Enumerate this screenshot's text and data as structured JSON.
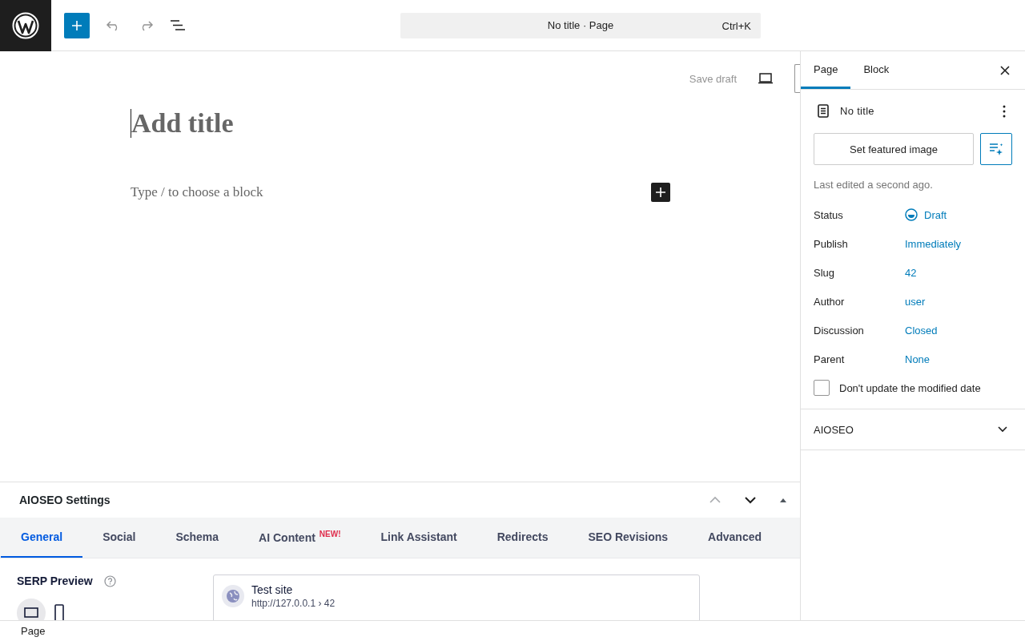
{
  "toolbar": {
    "command_bar": {
      "title": "No title · Page",
      "shortcut": "Ctrl+K"
    }
  },
  "editor": {
    "save_draft": "Save draft",
    "title_placeholder": "Add title",
    "block_placeholder": "Type / to choose a block"
  },
  "sidebar": {
    "tabs": [
      {
        "label": "Page",
        "selected": true
      },
      {
        "label": "Block",
        "selected": false
      }
    ],
    "document_title": "No title",
    "featured_image_button": "Set featured image",
    "last_edited": "Last edited a second ago.",
    "fields": [
      {
        "label": "Status",
        "value": "Draft",
        "kind": "status"
      },
      {
        "label": "Publish",
        "value": "Immediately",
        "kind": "link"
      },
      {
        "label": "Slug",
        "value": "42",
        "kind": "link"
      },
      {
        "label": "Author",
        "value": "user",
        "kind": "link"
      },
      {
        "label": "Discussion",
        "value": "Closed",
        "kind": "link"
      },
      {
        "label": "Parent",
        "value": "None",
        "kind": "link"
      }
    ],
    "checkbox": {
      "label": "Don't update the modified date",
      "checked": false
    },
    "panels": [
      {
        "title": "AIOSEO",
        "expanded": false
      }
    ]
  },
  "aioseo": {
    "title": "AIOSEO Settings",
    "tabs": [
      {
        "label": "General",
        "selected": true
      },
      {
        "label": "Social",
        "selected": false
      },
      {
        "label": "Schema",
        "selected": false
      },
      {
        "label": "AI Content",
        "badge": "NEW!",
        "selected": false
      },
      {
        "label": "Link Assistant",
        "selected": false
      },
      {
        "label": "Redirects",
        "selected": false
      },
      {
        "label": "SEO Revisions",
        "selected": false
      },
      {
        "label": "Advanced",
        "selected": false
      }
    ],
    "serp_preview": {
      "label": "SERP Preview",
      "site_name": "Test site",
      "url": "http://127.0.0.1 › 42"
    }
  },
  "status_bar": {
    "breadcrumb": "Page"
  }
}
